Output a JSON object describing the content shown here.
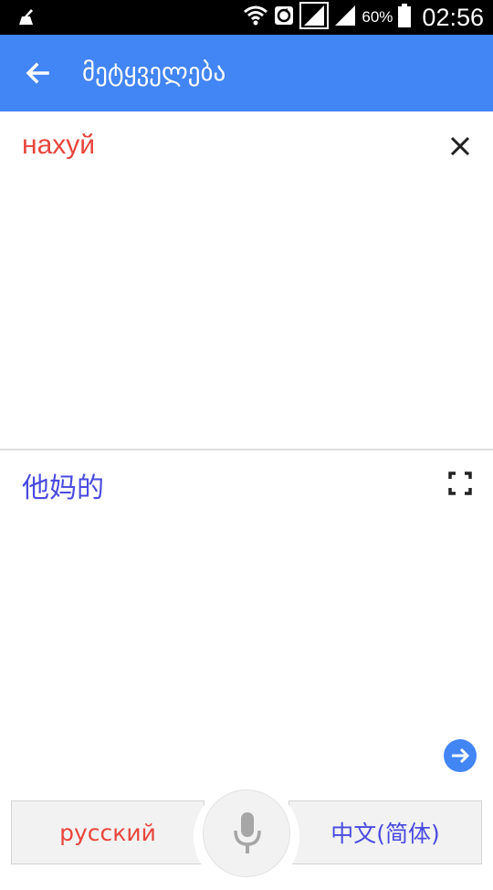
{
  "status_bar": {
    "battery": "60%",
    "time": "02:56",
    "icons": [
      "notification-cleaner-icon",
      "wifi-icon",
      "sync-icon",
      "signal-icon",
      "signal-icon-2",
      "battery-icon"
    ]
  },
  "app_bar": {
    "title": "მეტყველება",
    "back_icon": "arrow-back-icon"
  },
  "input": {
    "text": "нахуй",
    "clear_icon": "close-icon"
  },
  "output": {
    "text": "他妈的",
    "fullscreen_icon": "fullscreen-icon",
    "go_icon": "arrow-forward-circle-icon"
  },
  "bottom_bar": {
    "source_language": "русский",
    "target_language": "中文(简体)",
    "mic_icon": "microphone-icon"
  },
  "colors": {
    "app_bar": "#4285f4",
    "source_text": "#e8453c",
    "target_text": "#4a4ae0"
  }
}
